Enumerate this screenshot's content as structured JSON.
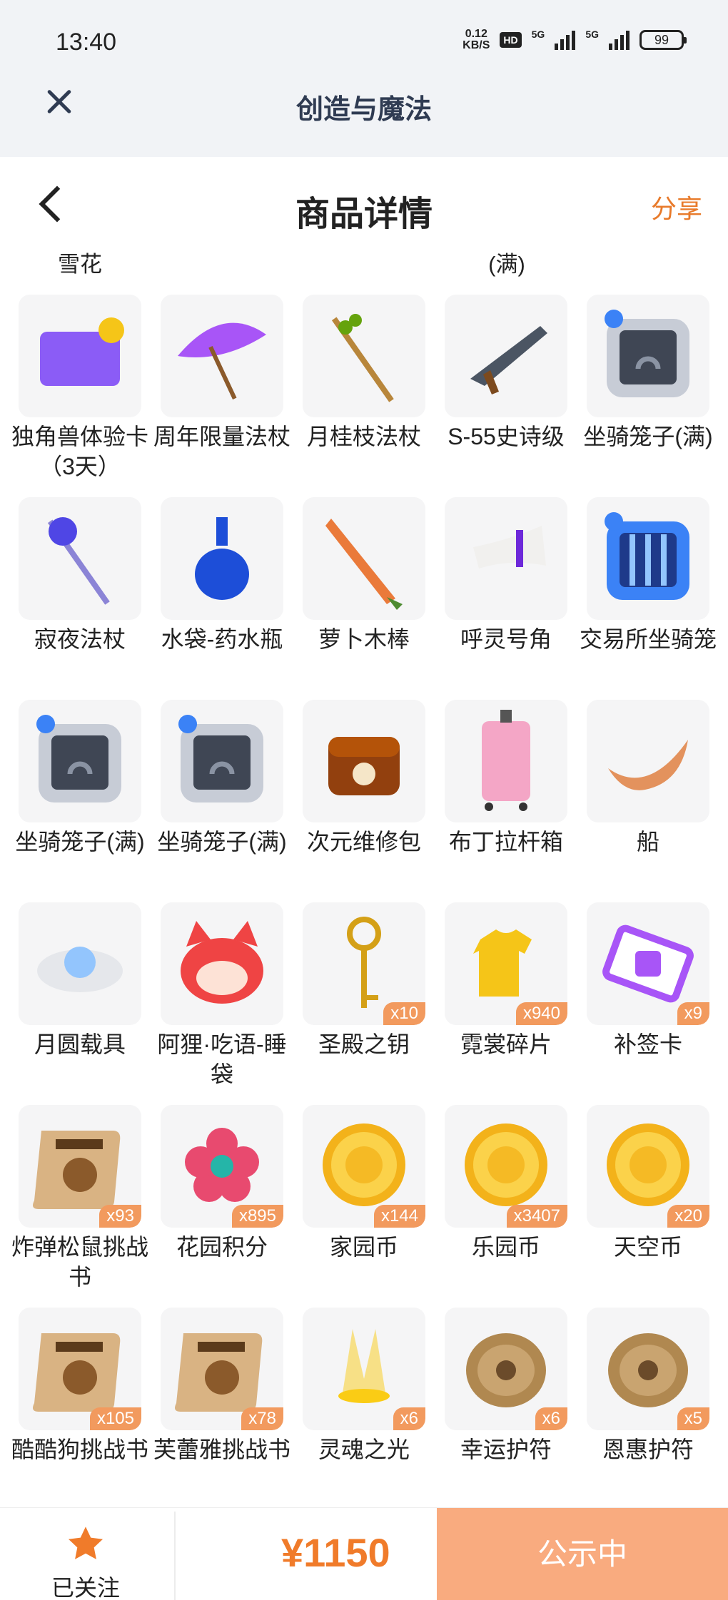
{
  "status_bar": {
    "time": "13:40",
    "net_speed_value": "0.12",
    "net_speed_unit": "KB/S",
    "hd_badge": "HD",
    "signal_1_label": "5G",
    "signal_2_label": "5G",
    "battery": "99"
  },
  "app_header": {
    "title": "创造与魔法",
    "close_icon": "close-icon"
  },
  "page_header": {
    "title": "商品详情",
    "share_label": "分享",
    "back_icon": "chevron-left-icon"
  },
  "carry_over": {
    "col1": "雪花",
    "col4": "(满)"
  },
  "items": [
    {
      "name": "独角兽体验卡（3天）",
      "qty": "",
      "icon": "unicorn-card-icon",
      "color": "#8b5cf6"
    },
    {
      "name": "周年限量法杖",
      "qty": "",
      "icon": "umbrella-staff-icon",
      "color": "#a855f7"
    },
    {
      "name": "月桂枝法杖",
      "qty": "",
      "icon": "laurel-staff-icon",
      "color": "#65a30d"
    },
    {
      "name": "S-55史诗级",
      "qty": "",
      "icon": "gun-icon",
      "color": "#4b5563"
    },
    {
      "name": "坐骑笼子(满)",
      "qty": "",
      "icon": "mount-cage-icon",
      "color": "#6b7280"
    },
    {
      "name": "寂夜法杖",
      "qty": "",
      "icon": "night-staff-icon",
      "color": "#4f46e5"
    },
    {
      "name": "水袋-药水瓶",
      "qty": "",
      "icon": "potion-bottle-icon",
      "color": "#1d4ed8"
    },
    {
      "name": "萝卜木棒",
      "qty": "",
      "icon": "carrot-stick-icon",
      "color": "#ea7a3a"
    },
    {
      "name": "呼灵号角",
      "qty": "",
      "icon": "horn-icon",
      "color": "#6d28d9"
    },
    {
      "name": "交易所坐骑笼",
      "qty": "",
      "icon": "exchange-cage-icon",
      "color": "#2563eb"
    },
    {
      "name": "坐骑笼子(满)",
      "qty": "",
      "icon": "mount-cage-icon",
      "color": "#6b7280"
    },
    {
      "name": "坐骑笼子(满)",
      "qty": "",
      "icon": "mount-cage-icon",
      "color": "#6b7280"
    },
    {
      "name": "次元维修包",
      "qty": "",
      "icon": "repair-bag-icon",
      "color": "#92400e"
    },
    {
      "name": "布丁拉杆箱",
      "qty": "",
      "icon": "suitcase-icon",
      "color": "#f4a6c6"
    },
    {
      "name": "船",
      "qty": "",
      "icon": "boat-icon",
      "color": "#e3925d"
    },
    {
      "name": "月圆载具",
      "qty": "",
      "icon": "moon-cloud-icon",
      "color": "#93c5fd"
    },
    {
      "name": "阿狸·吃语-睡袋",
      "qty": "",
      "icon": "fox-sleeping-bag-icon",
      "color": "#ef4444"
    },
    {
      "name": "圣殿之钥",
      "qty": "x10",
      "icon": "key-icon",
      "color": "#d4a017"
    },
    {
      "name": "霓裳碎片",
      "qty": "x940",
      "icon": "shirt-fragment-icon",
      "color": "#f5c518"
    },
    {
      "name": "补签卡",
      "qty": "x9",
      "icon": "sign-card-icon",
      "color": "#a855f7"
    },
    {
      "name": "炸弹松鼠挑战书",
      "qty": "x93",
      "icon": "wanted-scroll-icon",
      "color": "#8b5a2b"
    },
    {
      "name": "花园积分",
      "qty": "x895",
      "icon": "flower-icon",
      "color": "#e84a6f"
    },
    {
      "name": "家园币",
      "qty": "x144",
      "icon": "coin-icon",
      "color": "#f3b21a"
    },
    {
      "name": "乐园币",
      "qty": "x3407",
      "icon": "coin-chest-icon",
      "color": "#f3b21a"
    },
    {
      "name": "天空币",
      "qty": "x20",
      "icon": "coin-bow-icon",
      "color": "#f3b21a"
    },
    {
      "name": "酷酷狗挑战书",
      "qty": "x105",
      "icon": "wanted-scroll-icon",
      "color": "#8b5a2b"
    },
    {
      "name": "芙蕾雅挑战书",
      "qty": "x78",
      "icon": "wanted-scroll-icon",
      "color": "#8b5a2b"
    },
    {
      "name": "灵魂之光",
      "qty": "x6",
      "icon": "soul-light-icon",
      "color": "#facc15"
    },
    {
      "name": "幸运护符",
      "qty": "x6",
      "icon": "stone-amulet-icon",
      "color": "#b08850"
    },
    {
      "name": "恩惠护符",
      "qty": "x5",
      "icon": "stone-amulet-icon",
      "color": "#b08850"
    }
  ],
  "bottom_bar": {
    "follow_label": "已关注",
    "follow_icon": "star-icon",
    "price": "¥1150",
    "status_label": "公示中",
    "accent": "#f07b2a"
  }
}
